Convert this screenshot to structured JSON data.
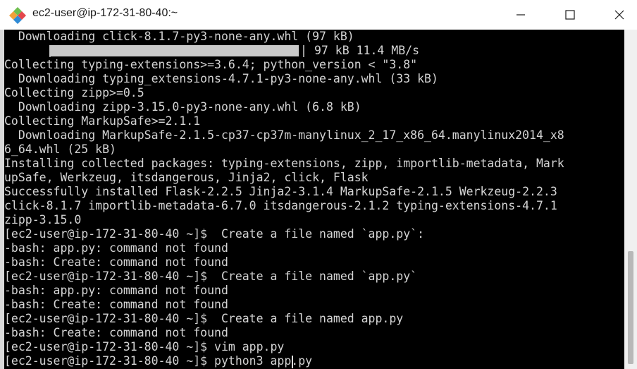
{
  "window": {
    "title": "ec2-user@ip-172-31-80-40:~",
    "icon": "putty-icon"
  },
  "terminal": {
    "progress": {
      "fraction": 1.0,
      "text": "97 kB 11.4 MB/s"
    },
    "lines": [
      "  Downloading click-8.1.7-py3-none-any.whl (97 kB)",
      "",
      "Collecting typing-extensions>=3.6.4; python_version < \"3.8\"",
      "  Downloading typing_extensions-4.7.1-py3-none-any.whl (33 kB)",
      "Collecting zipp>=0.5",
      "  Downloading zipp-3.15.0-py3-none-any.whl (6.8 kB)",
      "Collecting MarkupSafe>=2.1.1",
      "  Downloading MarkupSafe-2.1.5-cp37-cp37m-manylinux_2_17_x86_64.manylinux2014_x8",
      "6_64.whl (25 kB)",
      "Installing collected packages: typing-extensions, zipp, importlib-metadata, Mark",
      "upSafe, Werkzeug, itsdangerous, Jinja2, click, Flask",
      "Successfully installed Flask-2.2.5 Jinja2-3.1.4 MarkupSafe-2.1.5 Werkzeug-2.2.3",
      "click-8.1.7 importlib-metadata-6.7.0 itsdangerous-2.1.2 typing-extensions-4.7.1",
      "zipp-3.15.0",
      "[ec2-user@ip-172-31-80-40 ~]$  Create a file named `app.py`:",
      "-bash: app.py: command not found",
      "-bash: Create: command not found",
      "[ec2-user@ip-172-31-80-40 ~]$  Create a file named `app.py`",
      "-bash: app.py: command not found",
      "-bash: Create: command not found",
      "[ec2-user@ip-172-31-80-40 ~]$  Create a file named app.py",
      "-bash: Create: command not found",
      "[ec2-user@ip-172-31-80-40 ~]$ vim app.py",
      "[ec2-user@ip-172-31-80-40 ~]$ python3 app.py"
    ]
  },
  "controls": {
    "minimize": "minimize-icon",
    "maximize": "maximize-icon",
    "close": "close-icon"
  }
}
